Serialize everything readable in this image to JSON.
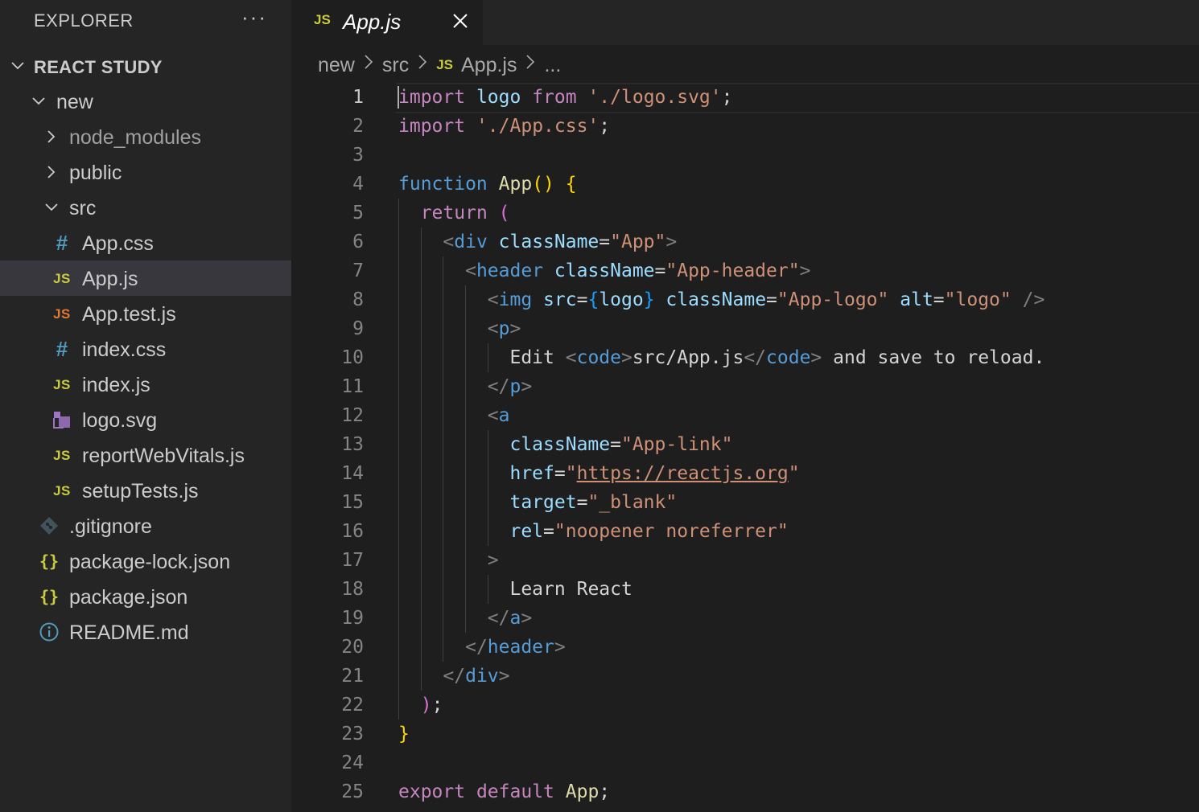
{
  "explorer": {
    "title": "EXPLORER",
    "more": "···",
    "root": "REACT STUDY",
    "items": [
      {
        "label": "new",
        "kind": "folder-open",
        "depth": 1
      },
      {
        "label": "node_modules",
        "kind": "folder",
        "depth": 2
      },
      {
        "label": "public",
        "kind": "folder",
        "depth": 2
      },
      {
        "label": "src",
        "kind": "folder-open",
        "depth": 2
      },
      {
        "label": "App.css",
        "kind": "css",
        "icon": "#",
        "depth": 3
      },
      {
        "label": "App.js",
        "kind": "js",
        "icon": "JS",
        "depth": 3,
        "selected": true
      },
      {
        "label": "App.test.js",
        "kind": "js-test",
        "icon": "JS",
        "depth": 3
      },
      {
        "label": "index.css",
        "kind": "css",
        "icon": "#",
        "depth": 3
      },
      {
        "label": "index.js",
        "kind": "js",
        "icon": "JS",
        "depth": 3
      },
      {
        "label": "logo.svg",
        "kind": "svg",
        "depth": 3
      },
      {
        "label": "reportWebVitals.js",
        "kind": "js",
        "icon": "JS",
        "depth": 3
      },
      {
        "label": "setupTests.js",
        "kind": "js",
        "icon": "JS",
        "depth": 3
      },
      {
        "label": ".gitignore",
        "kind": "git",
        "depth": 2
      },
      {
        "label": "package-lock.json",
        "kind": "json",
        "icon": "{}",
        "depth": 2
      },
      {
        "label": "package.json",
        "kind": "json",
        "icon": "{}",
        "depth": 2
      },
      {
        "label": "README.md",
        "kind": "info",
        "icon": "ⓘ",
        "depth": 2
      }
    ]
  },
  "tab": {
    "icon": "JS",
    "label": "App.js"
  },
  "breadcrumb": {
    "parts": [
      "new",
      "src",
      "App.js",
      "..."
    ],
    "js_icon": "JS"
  },
  "editor": {
    "active_line": 1,
    "lines": [
      "import logo from './logo.svg';",
      "import './App.css';",
      "",
      "function App() {",
      "  return (",
      "    <div className=\"App\">",
      "      <header className=\"App-header\">",
      "        <img src={logo} className=\"App-logo\" alt=\"logo\" />",
      "        <p>",
      "          Edit <code>src/App.js</code> and save to reload.",
      "        </p>",
      "        <a",
      "          className=\"App-link\"",
      "          href=\"https://reactjs.org\"",
      "          target=\"_blank\"",
      "          rel=\"noopener noreferrer\"",
      "        >",
      "          Learn React",
      "        </a>",
      "      </header>",
      "    </div>",
      "  );",
      "}",
      "",
      "export default App;"
    ]
  },
  "colors": {
    "background": "#1e1e1e",
    "sidebar": "#252526",
    "selection": "#37373d",
    "keyword": "#569cd6",
    "control": "#c586c0",
    "string": "#ce9178",
    "variable": "#9cdcfe",
    "function": "#dcdcaa",
    "js_icon": "#cbcb41"
  }
}
